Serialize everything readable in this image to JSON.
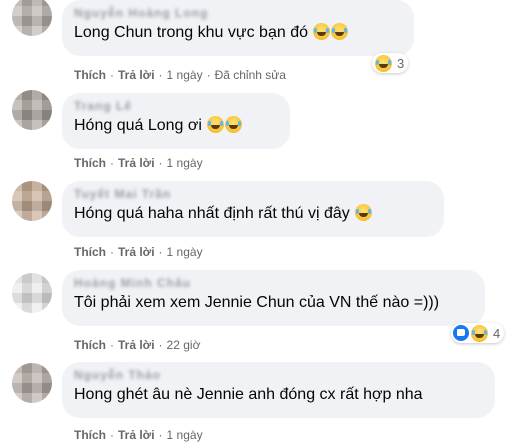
{
  "comments": [
    {
      "author": "Nguyễn Hoàng Long",
      "text": "Long Chun trong khu vực bạn đó",
      "emojis": [
        "rofl-emoji",
        "rofl-emoji"
      ],
      "actions": {
        "like": "Thích",
        "reply": "Trả lời",
        "time": "1 ngày",
        "edited": "Đã chỉnh sửa"
      },
      "reaction": {
        "icons": [
          "laughing-emoji"
        ],
        "count": "3"
      }
    },
    {
      "author": "Trang Lê",
      "text": "Hóng quá Long ơi",
      "emojis": [
        "joy-emoji",
        "joy-emoji"
      ],
      "actions": {
        "like": "Thích",
        "reply": "Trả lời",
        "time": "1 ngày"
      }
    },
    {
      "author": "Tuyết Mai Trần",
      "text": "Hóng quá haha nhất định rất thú vị đây",
      "emojis": [
        "rofl-emoji"
      ],
      "actions": {
        "like": "Thích",
        "reply": "Trả lời",
        "time": "1 ngày"
      }
    },
    {
      "author": "Hoàng Minh Châu",
      "text": "Tôi phải xem xem Jennie Chun của VN thế nào =)))",
      "emojis": [],
      "actions": {
        "like": "Thích",
        "reply": "Trả lời",
        "time": "22 giờ"
      },
      "reaction": {
        "icons": [
          "like-icon",
          "laughing-emoji"
        ],
        "count": "4"
      }
    },
    {
      "author": "Nguyễn Thảo",
      "text": "Hong ghét âu nè Jennie anh đóng cx rất hợp nha",
      "emojis": [],
      "actions": {
        "like": "Thích",
        "reply": "Trả lời",
        "time": "1 ngày"
      }
    }
  ]
}
